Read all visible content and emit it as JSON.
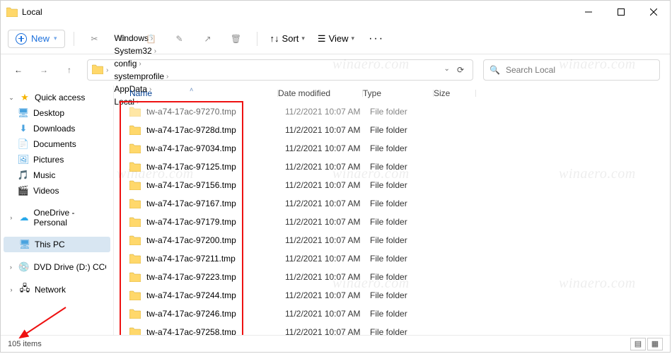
{
  "title": "Local",
  "toolbar": {
    "new": "New",
    "sort": "Sort",
    "view": "View"
  },
  "breadcrumb": [
    "Windows",
    "System32",
    "config",
    "systemprofile",
    "AppData",
    "Local"
  ],
  "search_placeholder": "Search Local",
  "sidebar": {
    "quick": {
      "label": "Quick access",
      "items": [
        "Desktop",
        "Downloads",
        "Documents",
        "Pictures",
        "Music",
        "Videos"
      ]
    },
    "onedrive": "OneDrive - Personal",
    "thispc": "This PC",
    "dvd": "DVD Drive (D:) CCCO",
    "network": "Network"
  },
  "columns": {
    "name": "Name",
    "date": "Date modified",
    "type": "Type",
    "size": "Size"
  },
  "rows": [
    {
      "name": "tw-a74-17ac-97270.tmp",
      "date": "11/2/2021 10:07 AM",
      "type": "File folder",
      "cut": true
    },
    {
      "name": "tw-a74-17ac-9728d.tmp",
      "date": "11/2/2021 10:07 AM",
      "type": "File folder"
    },
    {
      "name": "tw-a74-17ac-97034.tmp",
      "date": "11/2/2021 10:07 AM",
      "type": "File folder"
    },
    {
      "name": "tw-a74-17ac-97125.tmp",
      "date": "11/2/2021 10:07 AM",
      "type": "File folder"
    },
    {
      "name": "tw-a74-17ac-97156.tmp",
      "date": "11/2/2021 10:07 AM",
      "type": "File folder"
    },
    {
      "name": "tw-a74-17ac-97167.tmp",
      "date": "11/2/2021 10:07 AM",
      "type": "File folder"
    },
    {
      "name": "tw-a74-17ac-97179.tmp",
      "date": "11/2/2021 10:07 AM",
      "type": "File folder"
    },
    {
      "name": "tw-a74-17ac-97200.tmp",
      "date": "11/2/2021 10:07 AM",
      "type": "File folder"
    },
    {
      "name": "tw-a74-17ac-97211.tmp",
      "date": "11/2/2021 10:07 AM",
      "type": "File folder"
    },
    {
      "name": "tw-a74-17ac-97223.tmp",
      "date": "11/2/2021 10:07 AM",
      "type": "File folder"
    },
    {
      "name": "tw-a74-17ac-97244.tmp",
      "date": "11/2/2021 10:07 AM",
      "type": "File folder"
    },
    {
      "name": "tw-a74-17ac-97246.tmp",
      "date": "11/2/2021 10:07 AM",
      "type": "File folder"
    },
    {
      "name": "tw-a74-17ac-97258.tmp",
      "date": "11/2/2021 10:07 AM",
      "type": "File folder"
    }
  ],
  "status": "105 items",
  "watermark": "winaero.com"
}
